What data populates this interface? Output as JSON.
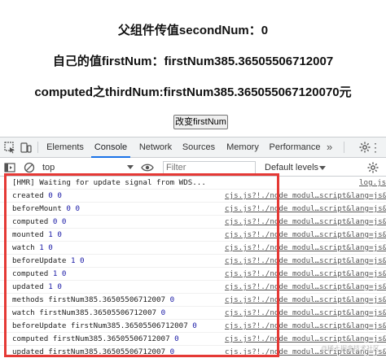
{
  "page": {
    "line1": "父组件传值secondNum：0",
    "line2": "自己的值firstNum：firstNum385.36505506712007",
    "line3": "computed之thirdNum:firstNum385.365055067120070元",
    "button_label": "改变firstNum"
  },
  "devtools": {
    "tabs": [
      "Elements",
      "Console",
      "Network",
      "Sources",
      "Memory",
      "Performance"
    ],
    "active_tab": "Console",
    "more_tabs": "»",
    "context": "top",
    "filter_placeholder": "Filter",
    "levels": "Default levels"
  },
  "console": {
    "rows": [
      {
        "text": "[HMR] Waiting for update signal from WDS...",
        "nums": "",
        "source": "log.js"
      },
      {
        "text": "created",
        "nums": "0 0",
        "source": "cjs.js?!./node_modul…script&lang=js&"
      },
      {
        "text": "beforeMount",
        "nums": "0 0",
        "source": "cjs.js?!./node_modul…script&lang=js&"
      },
      {
        "text": "computed",
        "nums": "0 0",
        "source": "cjs.js?!./node_modul…script&lang=js&"
      },
      {
        "text": "mounted",
        "nums": "1 0",
        "source": "cjs.js?!./node_modul…script&lang=js&"
      },
      {
        "text": "watch",
        "nums": "1 0",
        "source": "cjs.js?!./node_modul…script&lang=js&"
      },
      {
        "text": "beforeUpdate",
        "nums": "1 0",
        "source": "cjs.js?!./node_modul…script&lang=js&"
      },
      {
        "text": "computed",
        "nums": "1 0",
        "source": "cjs.js?!./node_modul…script&lang=js&"
      },
      {
        "text": "updated",
        "nums": "1 0",
        "source": "cjs.js?!./node_modul…script&lang=js&"
      },
      {
        "text": "methods firstNum385.36505506712007",
        "nums": "0",
        "source": "cjs.js?!./node_modul…script&lang=js&"
      },
      {
        "text": "watch firstNum385.36505506712007",
        "nums": "0",
        "source": "cjs.js?!./node_modul…script&lang=js&"
      },
      {
        "text": "beforeUpdate firstNum385.36505506712007",
        "nums": "0",
        "source": "cjs.js?!./node_modul…script&lang=js&"
      },
      {
        "text": "computed firstNum385.36505506712007",
        "nums": "0",
        "source": "cjs.js?!./node_modul…script&lang=js&"
      },
      {
        "text": "updated firstNum385.36505506712007",
        "nums": "0",
        "source": "cjs.js?!./node_modul…script&lang=js&"
      }
    ]
  },
  "watermark": "@稀土掘金技术社区",
  "colors": {
    "accent": "#1a73e8",
    "highlight": "#e53935",
    "number": "#1a1aa6"
  }
}
